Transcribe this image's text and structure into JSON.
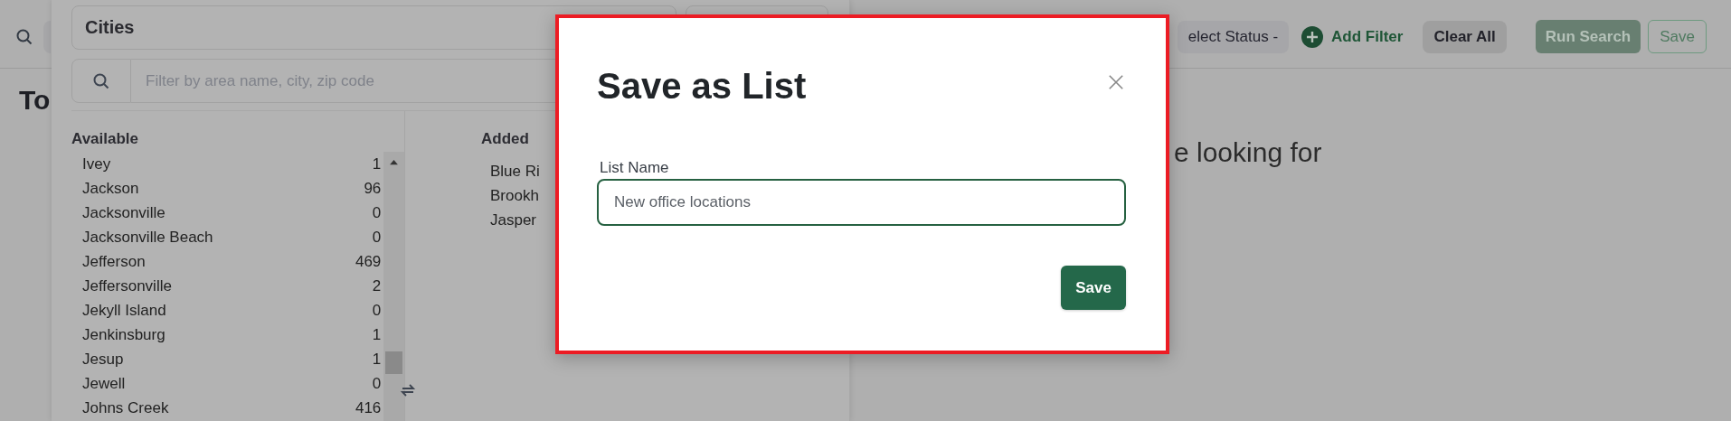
{
  "header": {
    "status_filter": "elect Status -",
    "add_filter": "Add Filter",
    "clear_all": "Clear All",
    "run_search": "Run Search",
    "save": "Save"
  },
  "page": {
    "heading": "To",
    "message": "e looking for"
  },
  "panel": {
    "select_value": "Cities",
    "filter_placeholder": "Filter by area name, city, zip code",
    "available_title": "Available",
    "added_title": "Added",
    "available": [
      {
        "name": "Ivey",
        "count": "1"
      },
      {
        "name": "Jackson",
        "count": "96"
      },
      {
        "name": "Jacksonville",
        "count": "0"
      },
      {
        "name": "Jacksonville Beach",
        "count": "0"
      },
      {
        "name": "Jefferson",
        "count": "469"
      },
      {
        "name": "Jeffersonville",
        "count": "2"
      },
      {
        "name": "Jekyll Island",
        "count": "0"
      },
      {
        "name": "Jenkinsburg",
        "count": "1"
      },
      {
        "name": "Jesup",
        "count": "1"
      },
      {
        "name": "Jewell",
        "count": "0"
      },
      {
        "name": "Johns Creek",
        "count": "416"
      }
    ],
    "added": [
      "Blue Ri",
      "Brookh",
      "Jasper"
    ]
  },
  "dialog": {
    "title": "Save as List",
    "field_label": "List Name",
    "value": "New office locations",
    "save": "Save"
  }
}
